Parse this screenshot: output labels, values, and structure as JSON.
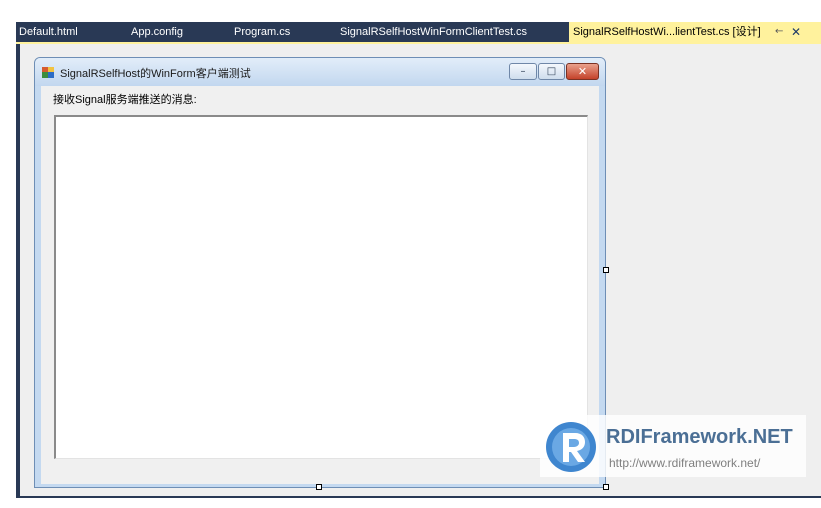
{
  "editor": {
    "tabs": [
      {
        "label": "Default.html"
      },
      {
        "label": "App.config"
      },
      {
        "label": "Program.cs"
      },
      {
        "label": "SignalRSelfHostWinFormClientTest.cs"
      },
      {
        "label": "SignalRSelfHostWi...lientTest.cs [设计]",
        "active": true
      }
    ],
    "pin_icon": "pin-icon",
    "close_icon": "close-icon",
    "tab_bar_color": "#293955",
    "active_tab_color": "#fff29d"
  },
  "form": {
    "title": "SignalRSelfHost的WinForm客户端测试",
    "app_icon": "winform-app-icon",
    "caption_buttons": {
      "minimize": "minimize-icon",
      "maximize": "maximize-icon",
      "close": "close-icon"
    },
    "label": "接收Signal服务端推送的消息:"
  },
  "watermark": {
    "name": "RDIFramework.NET",
    "url": "http://www.rdiframework.net/",
    "logo": "rdi-logo-icon",
    "color": "#4b6f95"
  }
}
